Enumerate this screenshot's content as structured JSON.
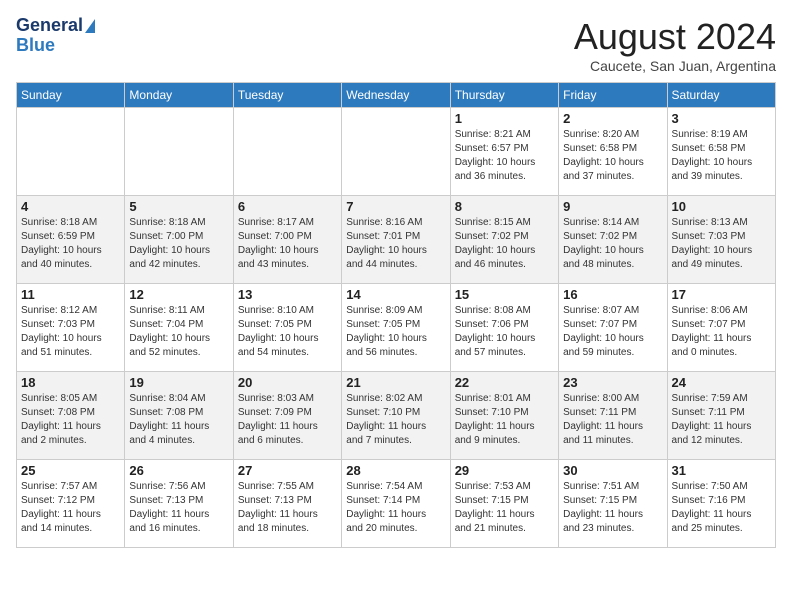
{
  "header": {
    "logo_line1": "General",
    "logo_line2": "Blue",
    "month_title": "August 2024",
    "subtitle": "Caucete, San Juan, Argentina"
  },
  "days_of_week": [
    "Sunday",
    "Monday",
    "Tuesday",
    "Wednesday",
    "Thursday",
    "Friday",
    "Saturday"
  ],
  "weeks": [
    [
      {
        "day": "",
        "detail": ""
      },
      {
        "day": "",
        "detail": ""
      },
      {
        "day": "",
        "detail": ""
      },
      {
        "day": "",
        "detail": ""
      },
      {
        "day": "1",
        "detail": "Sunrise: 8:21 AM\nSunset: 6:57 PM\nDaylight: 10 hours\nand 36 minutes."
      },
      {
        "day": "2",
        "detail": "Sunrise: 8:20 AM\nSunset: 6:58 PM\nDaylight: 10 hours\nand 37 minutes."
      },
      {
        "day": "3",
        "detail": "Sunrise: 8:19 AM\nSunset: 6:58 PM\nDaylight: 10 hours\nand 39 minutes."
      }
    ],
    [
      {
        "day": "4",
        "detail": "Sunrise: 8:18 AM\nSunset: 6:59 PM\nDaylight: 10 hours\nand 40 minutes."
      },
      {
        "day": "5",
        "detail": "Sunrise: 8:18 AM\nSunset: 7:00 PM\nDaylight: 10 hours\nand 42 minutes."
      },
      {
        "day": "6",
        "detail": "Sunrise: 8:17 AM\nSunset: 7:00 PM\nDaylight: 10 hours\nand 43 minutes."
      },
      {
        "day": "7",
        "detail": "Sunrise: 8:16 AM\nSunset: 7:01 PM\nDaylight: 10 hours\nand 44 minutes."
      },
      {
        "day": "8",
        "detail": "Sunrise: 8:15 AM\nSunset: 7:02 PM\nDaylight: 10 hours\nand 46 minutes."
      },
      {
        "day": "9",
        "detail": "Sunrise: 8:14 AM\nSunset: 7:02 PM\nDaylight: 10 hours\nand 48 minutes."
      },
      {
        "day": "10",
        "detail": "Sunrise: 8:13 AM\nSunset: 7:03 PM\nDaylight: 10 hours\nand 49 minutes."
      }
    ],
    [
      {
        "day": "11",
        "detail": "Sunrise: 8:12 AM\nSunset: 7:03 PM\nDaylight: 10 hours\nand 51 minutes."
      },
      {
        "day": "12",
        "detail": "Sunrise: 8:11 AM\nSunset: 7:04 PM\nDaylight: 10 hours\nand 52 minutes."
      },
      {
        "day": "13",
        "detail": "Sunrise: 8:10 AM\nSunset: 7:05 PM\nDaylight: 10 hours\nand 54 minutes."
      },
      {
        "day": "14",
        "detail": "Sunrise: 8:09 AM\nSunset: 7:05 PM\nDaylight: 10 hours\nand 56 minutes."
      },
      {
        "day": "15",
        "detail": "Sunrise: 8:08 AM\nSunset: 7:06 PM\nDaylight: 10 hours\nand 57 minutes."
      },
      {
        "day": "16",
        "detail": "Sunrise: 8:07 AM\nSunset: 7:07 PM\nDaylight: 10 hours\nand 59 minutes."
      },
      {
        "day": "17",
        "detail": "Sunrise: 8:06 AM\nSunset: 7:07 PM\nDaylight: 11 hours\nand 0 minutes."
      }
    ],
    [
      {
        "day": "18",
        "detail": "Sunrise: 8:05 AM\nSunset: 7:08 PM\nDaylight: 11 hours\nand 2 minutes."
      },
      {
        "day": "19",
        "detail": "Sunrise: 8:04 AM\nSunset: 7:08 PM\nDaylight: 11 hours\nand 4 minutes."
      },
      {
        "day": "20",
        "detail": "Sunrise: 8:03 AM\nSunset: 7:09 PM\nDaylight: 11 hours\nand 6 minutes."
      },
      {
        "day": "21",
        "detail": "Sunrise: 8:02 AM\nSunset: 7:10 PM\nDaylight: 11 hours\nand 7 minutes."
      },
      {
        "day": "22",
        "detail": "Sunrise: 8:01 AM\nSunset: 7:10 PM\nDaylight: 11 hours\nand 9 minutes."
      },
      {
        "day": "23",
        "detail": "Sunrise: 8:00 AM\nSunset: 7:11 PM\nDaylight: 11 hours\nand 11 minutes."
      },
      {
        "day": "24",
        "detail": "Sunrise: 7:59 AM\nSunset: 7:11 PM\nDaylight: 11 hours\nand 12 minutes."
      }
    ],
    [
      {
        "day": "25",
        "detail": "Sunrise: 7:57 AM\nSunset: 7:12 PM\nDaylight: 11 hours\nand 14 minutes."
      },
      {
        "day": "26",
        "detail": "Sunrise: 7:56 AM\nSunset: 7:13 PM\nDaylight: 11 hours\nand 16 minutes."
      },
      {
        "day": "27",
        "detail": "Sunrise: 7:55 AM\nSunset: 7:13 PM\nDaylight: 11 hours\nand 18 minutes."
      },
      {
        "day": "28",
        "detail": "Sunrise: 7:54 AM\nSunset: 7:14 PM\nDaylight: 11 hours\nand 20 minutes."
      },
      {
        "day": "29",
        "detail": "Sunrise: 7:53 AM\nSunset: 7:15 PM\nDaylight: 11 hours\nand 21 minutes."
      },
      {
        "day": "30",
        "detail": "Sunrise: 7:51 AM\nSunset: 7:15 PM\nDaylight: 11 hours\nand 23 minutes."
      },
      {
        "day": "31",
        "detail": "Sunrise: 7:50 AM\nSunset: 7:16 PM\nDaylight: 11 hours\nand 25 minutes."
      }
    ]
  ]
}
